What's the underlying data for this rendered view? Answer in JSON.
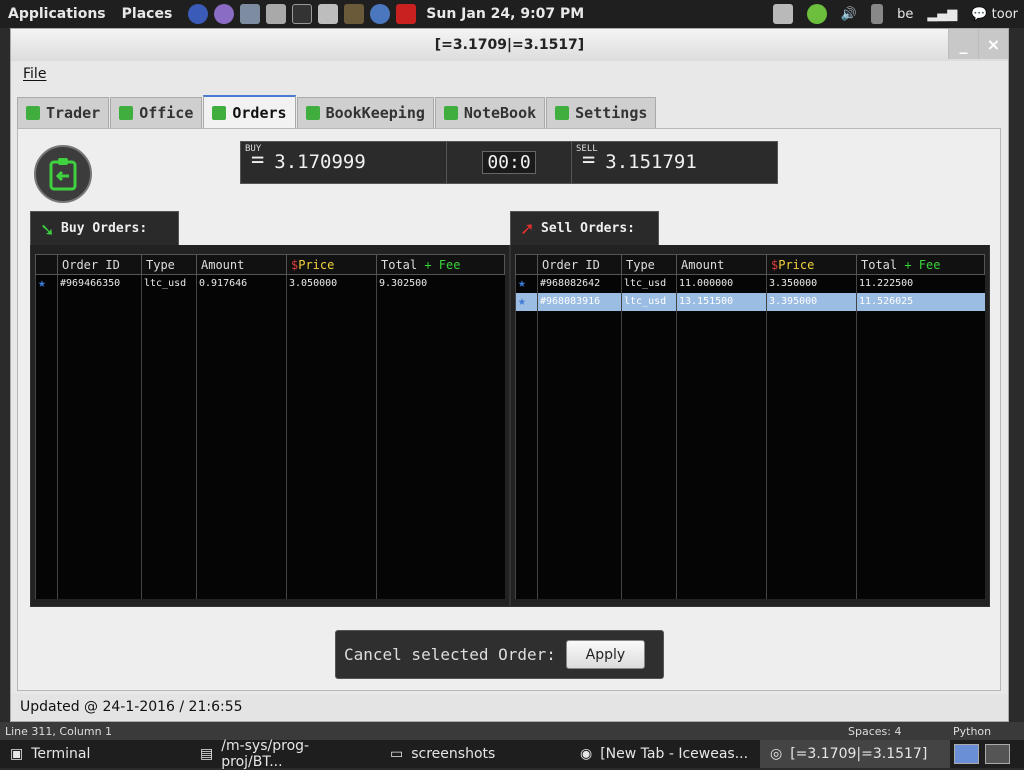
{
  "top_panel": {
    "applications": "Applications",
    "places": "Places",
    "clock": "Sun Jan 24,  9:07 PM",
    "keyboard_layout": "be",
    "user": "toor"
  },
  "window": {
    "title": "[=3.1709|=3.1517]",
    "minimize": "_",
    "close": "×",
    "menu_file": "File"
  },
  "tabs": [
    {
      "label": "Trader"
    },
    {
      "label": "Office"
    },
    {
      "label": "Orders"
    },
    {
      "label": "BookKeeping"
    },
    {
      "label": "NoteBook"
    },
    {
      "label": "Settings"
    }
  ],
  "ticker": {
    "buy_label": "BUY",
    "buy_value": "3.170999",
    "timer": "00:0",
    "sell_label": "SELL",
    "sell_value": "3.151791",
    "eq": "="
  },
  "buy_orders": {
    "title": "Buy Orders:",
    "headers": {
      "id": "Order ID",
      "type": "Type",
      "amount": "Amount",
      "price": "Price",
      "total": "Total",
      "fee": "+ Fee"
    },
    "rows": [
      {
        "id": "#969466350",
        "type": "ltc_usd",
        "amount": "0.917646",
        "price": "3.050000",
        "total": "9.302500"
      }
    ]
  },
  "sell_orders": {
    "title": "Sell Orders:",
    "headers": {
      "id": "Order ID",
      "type": "Type",
      "amount": "Amount",
      "price": "Price",
      "total": "Total",
      "fee": "+ Fee"
    },
    "rows": [
      {
        "id": "#968082642",
        "type": "ltc_usd",
        "amount": "11.000000",
        "price": "3.350000",
        "total": "11.222500"
      },
      {
        "id": "#968083916",
        "type": "ltc_usd",
        "amount": "13.151500",
        "price": "3.395000",
        "total": "11.526025"
      }
    ]
  },
  "cancel": {
    "label": "Cancel selected Order:",
    "button": "Apply"
  },
  "status": "Updated @ 24-1-2016 / 21:6:55",
  "editor_bar": {
    "position": "Line 311, Column 1",
    "spaces": "Spaces: 4",
    "language": "Python"
  },
  "taskbar": [
    {
      "label": "Terminal"
    },
    {
      "label": "/m-sys/prog-proj/BT..."
    },
    {
      "label": "screenshots"
    },
    {
      "label": "[New Tab - Iceweas..."
    },
    {
      "label": "[=3.1709|=3.1517]"
    }
  ]
}
